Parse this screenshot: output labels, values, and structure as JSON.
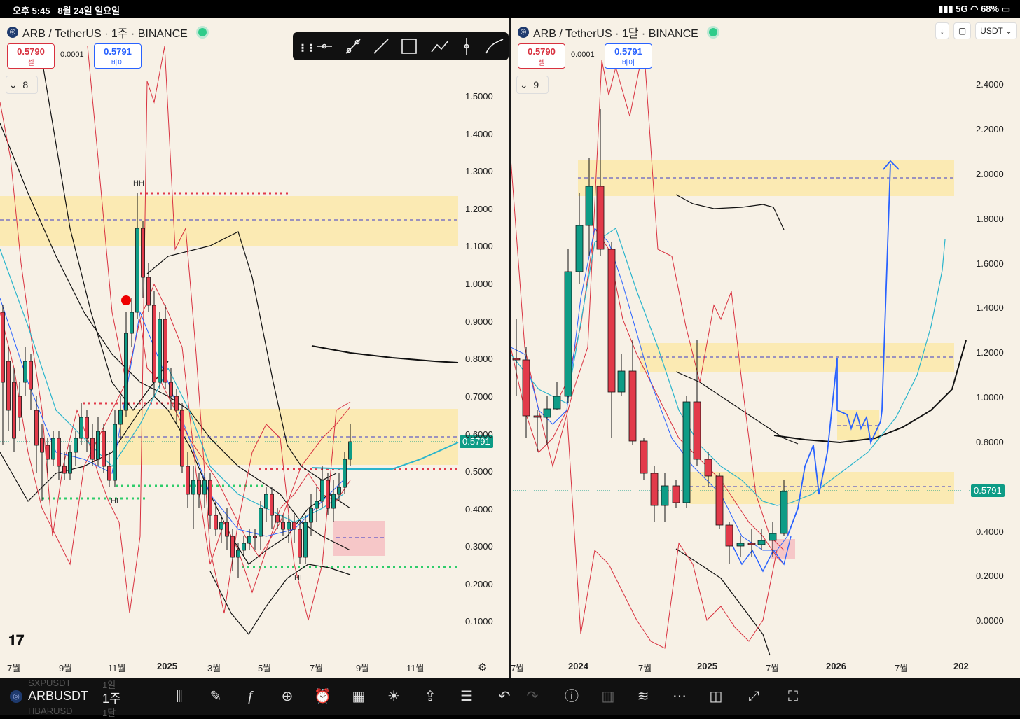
{
  "status_bar": {
    "time": "오후 5:45",
    "date": "8월 24일 일요일",
    "network": "5G",
    "battery": "68%"
  },
  "left_chart": {
    "title": "ARB / TetherUS · 1주 · BINANCE",
    "sell_price": "0.5790",
    "sell_label": "셀",
    "spread": "0.0001",
    "buy_price": "0.5791",
    "buy_label": "바이",
    "indicator_count": "8",
    "currency": "USDT",
    "current_price_tag": "0.5791",
    "y_labels": [
      "1.5000",
      "1.4000",
      "1.3000",
      "1.2000",
      "1.1000",
      "1.0000",
      "0.9000",
      "0.8000",
      "0.7000",
      "0.6000",
      "0.5000",
      "0.4000",
      "0.3000",
      "0.2000",
      "0.1000"
    ],
    "x_labels": [
      "7월",
      "9월",
      "11월",
      "2025",
      "3월",
      "5월",
      "7월",
      "9월",
      "11월"
    ],
    "annotations": [
      "HH",
      "HL",
      "HL"
    ]
  },
  "right_chart": {
    "title": "ARB / TetherUS · 1달 · BINANCE",
    "sell_price": "0.5790",
    "sell_label": "셀",
    "spread": "0.0001",
    "buy_price": "0.5791",
    "buy_label": "바이",
    "indicator_count": "9",
    "currency": "USDT",
    "current_price_tag": "0.5791",
    "y_labels": [
      "2.4000",
      "2.2000",
      "2.0000",
      "1.8000",
      "1.6000",
      "1.4000",
      "1.2000",
      "1.0000",
      "0.8000",
      "0.4000",
      "0.2000",
      "0.0000"
    ],
    "x_labels": [
      "7월",
      "2024",
      "7월",
      "2025",
      "7월",
      "2026",
      "7월",
      "202"
    ]
  },
  "bottom_bar": {
    "symbol": "ARBUSDT",
    "timeframe": "1주",
    "ghost_above": "SXPUSDT",
    "ghost_above_tf": "1일",
    "ghost_below": "HBARUSD",
    "ghost_below_tf": "1달"
  },
  "colors": {
    "up": "#0e9c86",
    "down": "#e23a4a",
    "zone_yellow": "#fbe9a6",
    "zone_pink": "#f5c2c4",
    "blue": "#2962ff",
    "cyan": "#2bb5cc"
  }
}
